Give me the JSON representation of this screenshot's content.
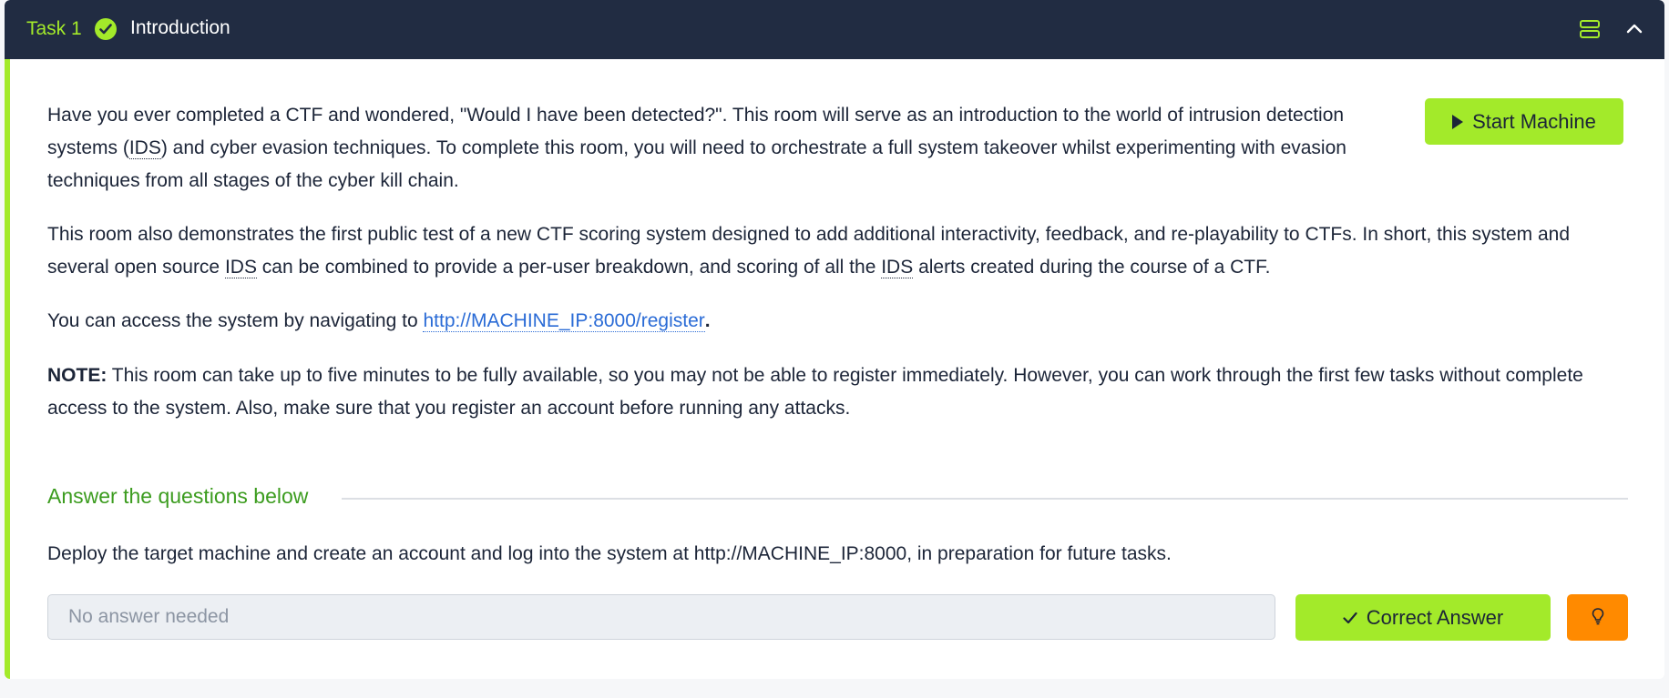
{
  "task": {
    "number_label": "Task 1",
    "title": "Introduction",
    "accent_color": "#a3ea2a",
    "header_color": "#212c42"
  },
  "header_icons": [
    "check-circle-icon",
    "server-icon",
    "chevron-up-icon"
  ],
  "start_machine_label": "Start Machine",
  "content": {
    "p1_text_1": "Have you ever completed a CTF and wondered, \"Would I have been detected?\". This room will serve as an introduction to the world of intrusion detection systems (",
    "p1_abbr": "IDS",
    "p1_text_2": ") and cyber evasion techniques. To complete this room, you will need to orchestrate a full system takeover whilst experimenting with evasion techniques from all stages of the cyber kill chain.",
    "p2_text_1": "This room also demonstrates the first public test of a new CTF scoring system designed to add additional interactivity, feedback, and re-playability to CTFs. In short, this system and several open source ",
    "p2_abbr_1": "IDS",
    "p2_text_2": " can be combined to provide a per-user breakdown, and scoring of all the ",
    "p2_abbr_2": "IDS",
    "p2_text_3": " alerts created during the course of a CTF.",
    "p3_text": "You can access the system by navigating to ",
    "p3_link": "http://MACHINE_IP:8000/register",
    "p3_end": ".",
    "note_label": "NOTE:",
    "note_text": " This room can take up to five minutes to be fully available, so you may not be able to register immediately. However, you can work through the first few tasks without complete access to the system. Also, make sure that you register an account before running any attacks."
  },
  "questions_section": {
    "title": "Answer the questions below",
    "question": "Deploy the target machine and create an account and log into the system at http://MACHINE_IP:8000, in preparation for future tasks.",
    "answer_placeholder": "No answer needed",
    "correct_label": "Correct Answer",
    "hint_icon": "lightbulb-icon",
    "hint_color": "#ff8a00"
  }
}
